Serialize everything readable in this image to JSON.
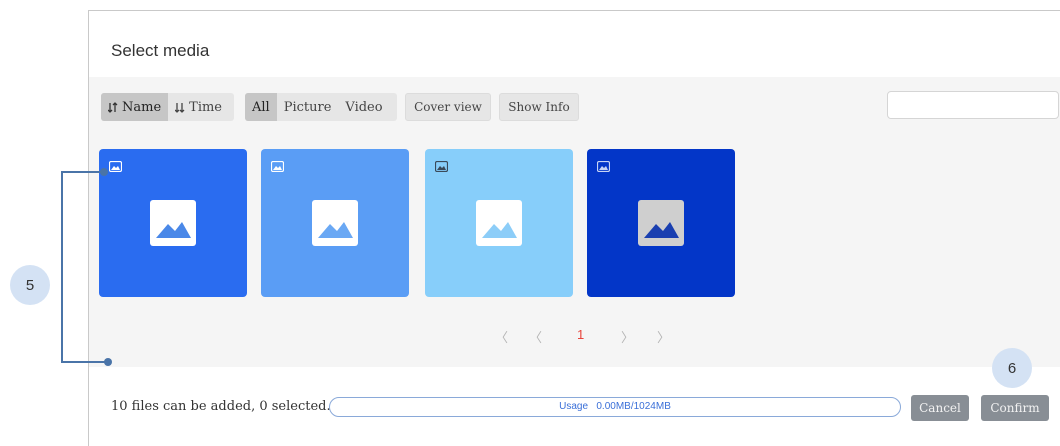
{
  "dialog": {
    "title": "Select media"
  },
  "toolbar": {
    "sort_options": [
      {
        "icon": "sort-icon",
        "label": "Name",
        "active": true
      },
      {
        "icon": "sort-icon",
        "label": "Time",
        "active": false
      }
    ],
    "filter_options": [
      {
        "label": "All",
        "active": true
      },
      {
        "label": "Picture",
        "active": false
      },
      {
        "label": "Video",
        "active": false
      }
    ],
    "cover_view_label": "Cover view",
    "show_info_label": "Show Info",
    "search": {
      "value": "",
      "placeholder": ""
    }
  },
  "media": [
    {
      "type": "picture",
      "icon": "image-icon",
      "color": "#2a6cf0"
    },
    {
      "type": "picture",
      "icon": "image-icon",
      "color": "#5a9df5"
    },
    {
      "type": "picture",
      "icon": "image-icon",
      "color": "#87cefa"
    },
    {
      "type": "picture",
      "icon": "image-icon",
      "color": "#0336c8"
    }
  ],
  "pagination": {
    "first": "〈",
    "prev": "〈",
    "current": "1",
    "next": "〉",
    "last": "〉"
  },
  "footer": {
    "status_text": "10 files can be added, 0 selected.",
    "usage_label": "Usage",
    "usage_value": "0.00MB/1024MB",
    "usage_fraction": 0,
    "cancel_label": "Cancel",
    "confirm_label": "Confirm"
  },
  "callouts": [
    {
      "number": "5"
    },
    {
      "number": "6"
    }
  ],
  "colors": {
    "accent": "#3a6fd8",
    "page_current": "#e8453c",
    "callout_badge": "#d4e2f4",
    "callout_line": "#4a74a8"
  }
}
